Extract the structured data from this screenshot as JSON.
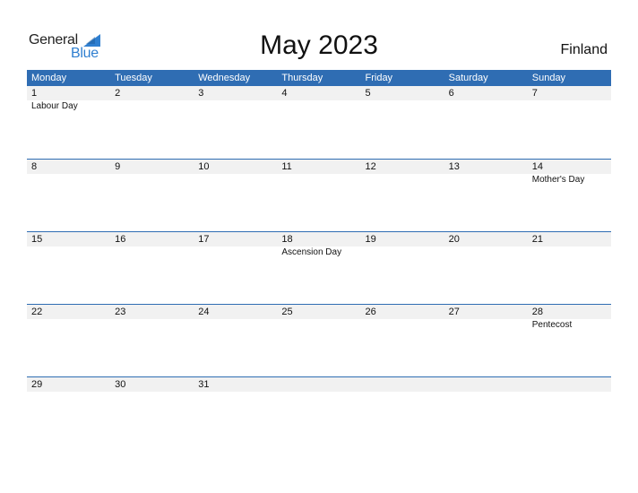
{
  "logo": {
    "text_general": "General",
    "text_blue": "Blue"
  },
  "title": "May 2023",
  "country": "Finland",
  "colors": {
    "header_bg": "#2f6db3",
    "day_bar_bg": "#f1f1f1",
    "logo_blue": "#2f7fd0"
  },
  "weekdays": [
    "Monday",
    "Tuesday",
    "Wednesday",
    "Thursday",
    "Friday",
    "Saturday",
    "Sunday"
  ],
  "weeks": [
    {
      "days": [
        {
          "num": "1",
          "holiday": "Labour Day"
        },
        {
          "num": "2",
          "holiday": ""
        },
        {
          "num": "3",
          "holiday": ""
        },
        {
          "num": "4",
          "holiday": ""
        },
        {
          "num": "5",
          "holiday": ""
        },
        {
          "num": "6",
          "holiday": ""
        },
        {
          "num": "7",
          "holiday": ""
        }
      ]
    },
    {
      "days": [
        {
          "num": "8",
          "holiday": ""
        },
        {
          "num": "9",
          "holiday": ""
        },
        {
          "num": "10",
          "holiday": ""
        },
        {
          "num": "11",
          "holiday": ""
        },
        {
          "num": "12",
          "holiday": ""
        },
        {
          "num": "13",
          "holiday": ""
        },
        {
          "num": "14",
          "holiday": "Mother's Day"
        }
      ]
    },
    {
      "days": [
        {
          "num": "15",
          "holiday": ""
        },
        {
          "num": "16",
          "holiday": ""
        },
        {
          "num": "17",
          "holiday": ""
        },
        {
          "num": "18",
          "holiday": "Ascension Day"
        },
        {
          "num": "19",
          "holiday": ""
        },
        {
          "num": "20",
          "holiday": ""
        },
        {
          "num": "21",
          "holiday": ""
        }
      ]
    },
    {
      "days": [
        {
          "num": "22",
          "holiday": ""
        },
        {
          "num": "23",
          "holiday": ""
        },
        {
          "num": "24",
          "holiday": ""
        },
        {
          "num": "25",
          "holiday": ""
        },
        {
          "num": "26",
          "holiday": ""
        },
        {
          "num": "27",
          "holiday": ""
        },
        {
          "num": "28",
          "holiday": "Pentecost"
        }
      ]
    },
    {
      "days": [
        {
          "num": "29",
          "holiday": ""
        },
        {
          "num": "30",
          "holiday": ""
        },
        {
          "num": "31",
          "holiday": ""
        },
        {
          "num": "",
          "holiday": ""
        },
        {
          "num": "",
          "holiday": ""
        },
        {
          "num": "",
          "holiday": ""
        },
        {
          "num": "",
          "holiday": ""
        }
      ]
    }
  ]
}
